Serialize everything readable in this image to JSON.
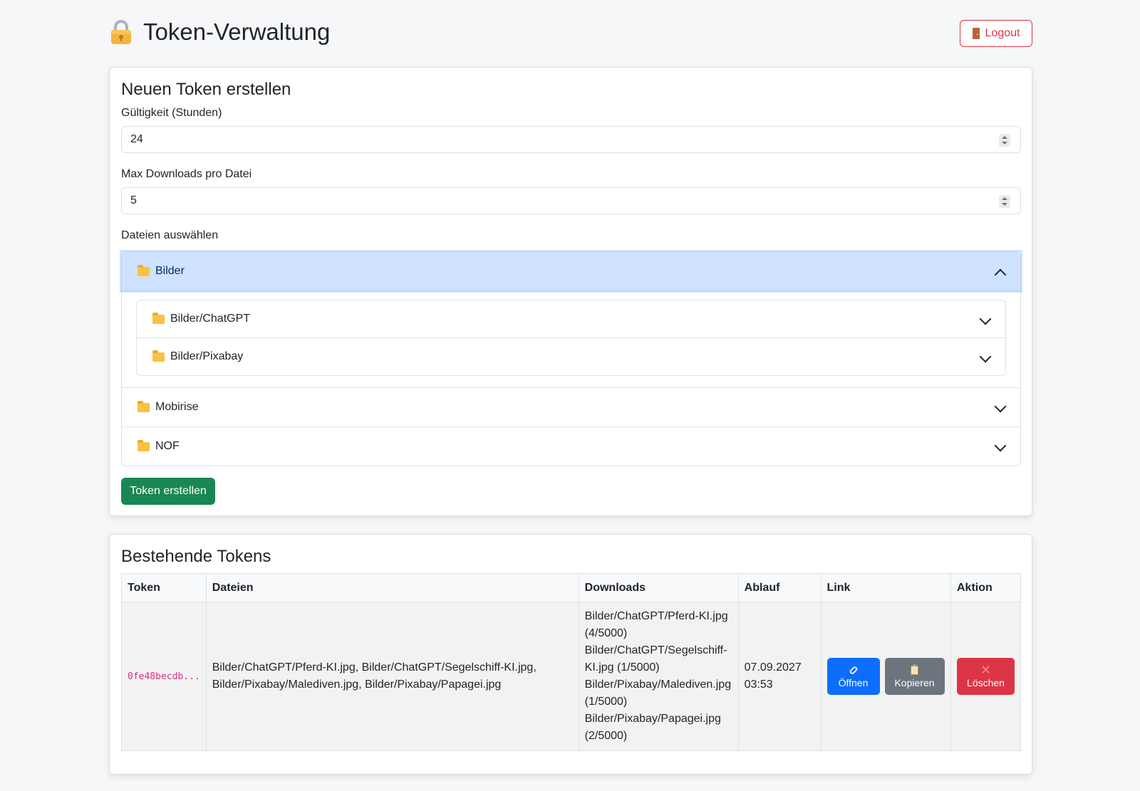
{
  "header": {
    "title": "Token-Verwaltung",
    "logout_label": "Logout"
  },
  "create": {
    "heading": "Neuen Token erstellen",
    "validity_label": "Gültigkeit (Stunden)",
    "validity_value": "24",
    "max_downloads_label": "Max Downloads pro Datei",
    "max_downloads_value": "5",
    "files_label": "Dateien auswählen",
    "folders": [
      {
        "name": "Bilder",
        "expanded": true,
        "subfolders": [
          {
            "name": "Bilder/ChatGPT",
            "expanded": false
          },
          {
            "name": "Bilder/Pixabay",
            "expanded": false
          }
        ]
      },
      {
        "name": "Mobirise",
        "expanded": false
      },
      {
        "name": "NOF",
        "expanded": false
      }
    ],
    "submit_label": "Token erstellen"
  },
  "tokens": {
    "heading": "Bestehende Tokens",
    "columns": [
      "Token",
      "Dateien",
      "Downloads",
      "Ablauf",
      "Link",
      "Aktion"
    ],
    "rows": [
      {
        "token": "0fe48becdb...",
        "files": "Bilder/ChatGPT/Pferd-KI.jpg, Bilder/ChatGPT/Segelschiff-KI.jpg, Bilder/Pixabay/Malediven.jpg, Bilder/Pixabay/Papagei.jpg",
        "downloads": [
          "Bilder/ChatGPT/Pferd-KI.jpg (4/5000)",
          "Bilder/ChatGPT/Segelschiff-KI.jpg (1/5000)",
          "Bilder/Pixabay/Malediven.jpg (1/5000)",
          "Bilder/Pixabay/Papagei.jpg (2/5000)"
        ],
        "expiry_date": "07.09.2027",
        "expiry_time": "03:53",
        "open_label": "Öffnen",
        "copy_label": "Kopieren",
        "delete_label": "Löschen"
      }
    ]
  },
  "colors": {
    "success": "#198754",
    "danger": "#dc3545",
    "primary": "#0d6efd",
    "secondary": "#6c757d",
    "accordion_active": "#cfe2ff"
  },
  "icons": {
    "title": "lock-icon",
    "logout": "door-icon",
    "folder": "folder-icon",
    "open": "link-icon",
    "copy": "clipboard-icon",
    "delete": "x-icon"
  }
}
